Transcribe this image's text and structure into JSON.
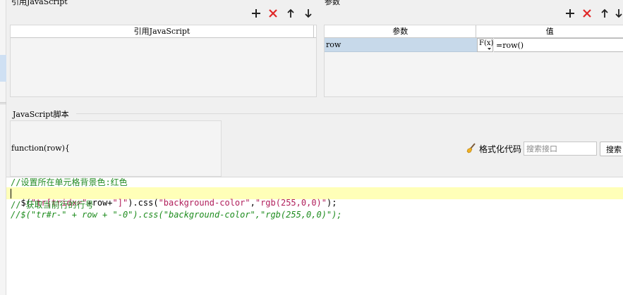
{
  "ref_js": {
    "title": "引用JavaScript",
    "column_header": "引用JavaScript",
    "toolbar": [
      "plus-icon",
      "delete-icon",
      "arrow-up-icon",
      "arrow-down-icon"
    ]
  },
  "params": {
    "title": "参数",
    "column_param": "参数",
    "column_value": "值",
    "rows": [
      {
        "param": "row",
        "fx_label": "F(x)",
        "value": "=row()"
      }
    ],
    "toolbar": [
      "plus-icon",
      "delete-icon",
      "arrow-up-icon",
      "arrow-down-icon"
    ]
  },
  "script": {
    "title": "JavaScript脚本",
    "signature": "function(row){",
    "format_label": "格式化代码",
    "search_placeholder": "搜索接口",
    "search_button": "搜索",
    "code_lines": [
      {
        "text": "//设置所在单元格背景色:红色",
        "kind": "comment"
      },
      {
        "text_prefix": "$(",
        "str1": "\"tr[tridx=\"",
        "mid1": "+row+",
        "str2": "\"]\"",
        "mid2": ").css(",
        "str3": "\"background-color\"",
        "mid3": ",",
        "str4": "\"rgb(255,0,0)\"",
        "suffix": ");",
        "kind": "code",
        "highlighted": true
      },
      {
        "text": "// 获取当前行的行号",
        "kind": "comment"
      },
      {
        "text": "//$(\"tr#r-\" + row + \"-0\").css(\"background-color\",\"rgb(255,0,0)\");",
        "kind": "comment-italic"
      }
    ]
  },
  "colors": {
    "highlight_line": "#ffffb8",
    "selected_row": "#c7d9ea",
    "delete_red": "#e02828",
    "comment_green": "#238b23",
    "string_magenta": "#b01e5a"
  }
}
